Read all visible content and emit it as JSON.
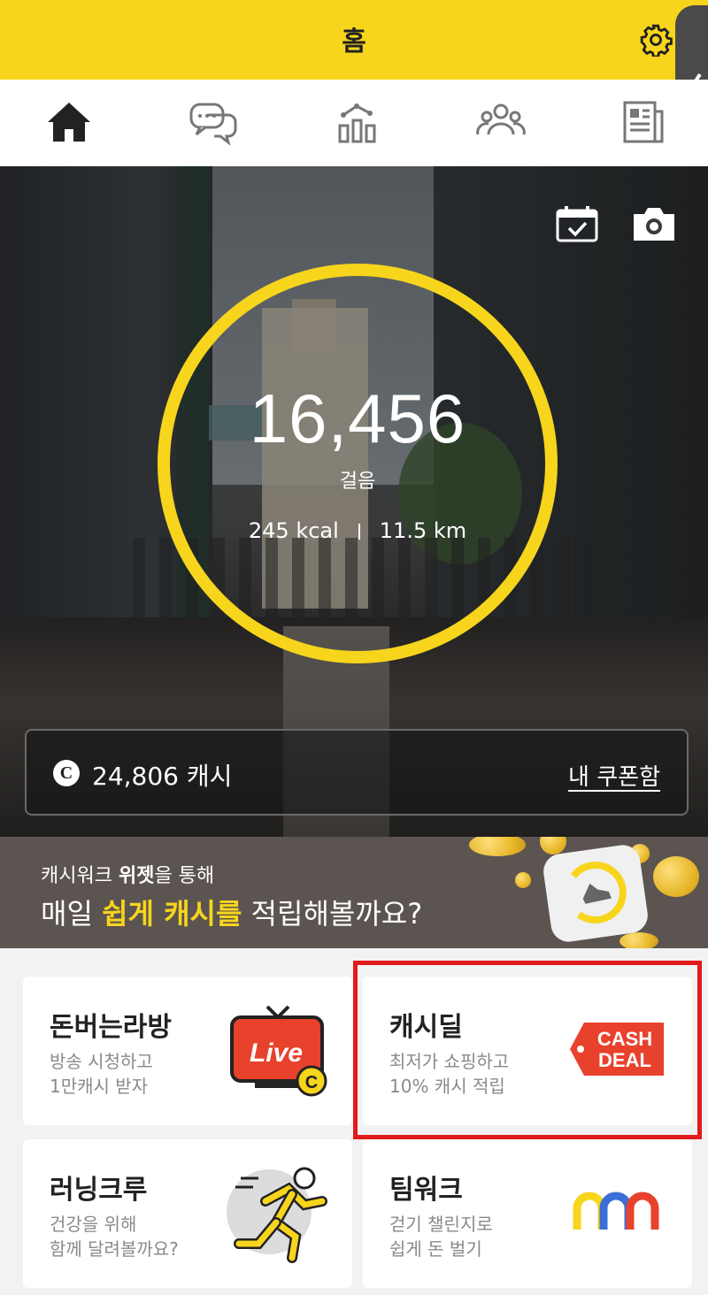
{
  "header": {
    "title": "홈",
    "settings_icon": "gear-icon",
    "side_handle_icon": "chevron-left-icon"
  },
  "nav": [
    {
      "name": "home",
      "icon": "home-icon",
      "active": true
    },
    {
      "name": "chat",
      "icon": "chat-icon",
      "active": false
    },
    {
      "name": "stats",
      "icon": "chart-icon",
      "active": false
    },
    {
      "name": "group",
      "icon": "people-icon",
      "active": false
    },
    {
      "name": "news",
      "icon": "news-icon",
      "active": false
    }
  ],
  "hero": {
    "steps": "16,456",
    "steps_label": "걸음",
    "kcal": "245 kcal",
    "distance": "11.5 km",
    "icons": [
      "calendar-check-icon",
      "camera-icon"
    ]
  },
  "cash": {
    "coin_symbol": "C",
    "amount": "24,806 캐시",
    "coupon_link": "내 쿠폰함"
  },
  "banner": {
    "line1_pre": "캐시워크 ",
    "line1_bold": "위젯",
    "line1_post": "을 통해",
    "line2_pre": "매일 ",
    "line2_highlight": "쉽게 캐시를",
    "line2_post": " 적립해볼까요?"
  },
  "cards": [
    {
      "title": "돈버는라방",
      "sub1": "방송 시청하고",
      "sub2": "1만캐시 받자",
      "icon": "live-tv-icon",
      "icon_text": "Live",
      "coin": "C"
    },
    {
      "title": "캐시딜",
      "sub1": "최저가 쇼핑하고",
      "sub2": "10% 캐시 적립",
      "icon": "cash-deal-tag-icon",
      "icon_text1": "CASH",
      "icon_text2": "DEAL"
    },
    {
      "title": "러닝크루",
      "sub1": "건강을 위해",
      "sub2": "함께 달려볼까요?",
      "icon": "runner-icon"
    },
    {
      "title": "팀워크",
      "sub1": "걷기 챌린지로",
      "sub2": "쉽게 돈 벌기",
      "icon": "teamwork-arches-icon"
    }
  ],
  "colors": {
    "accent": "#f7d51c",
    "highlight_border": "#e01b1b",
    "deal_red": "#e8412c"
  }
}
